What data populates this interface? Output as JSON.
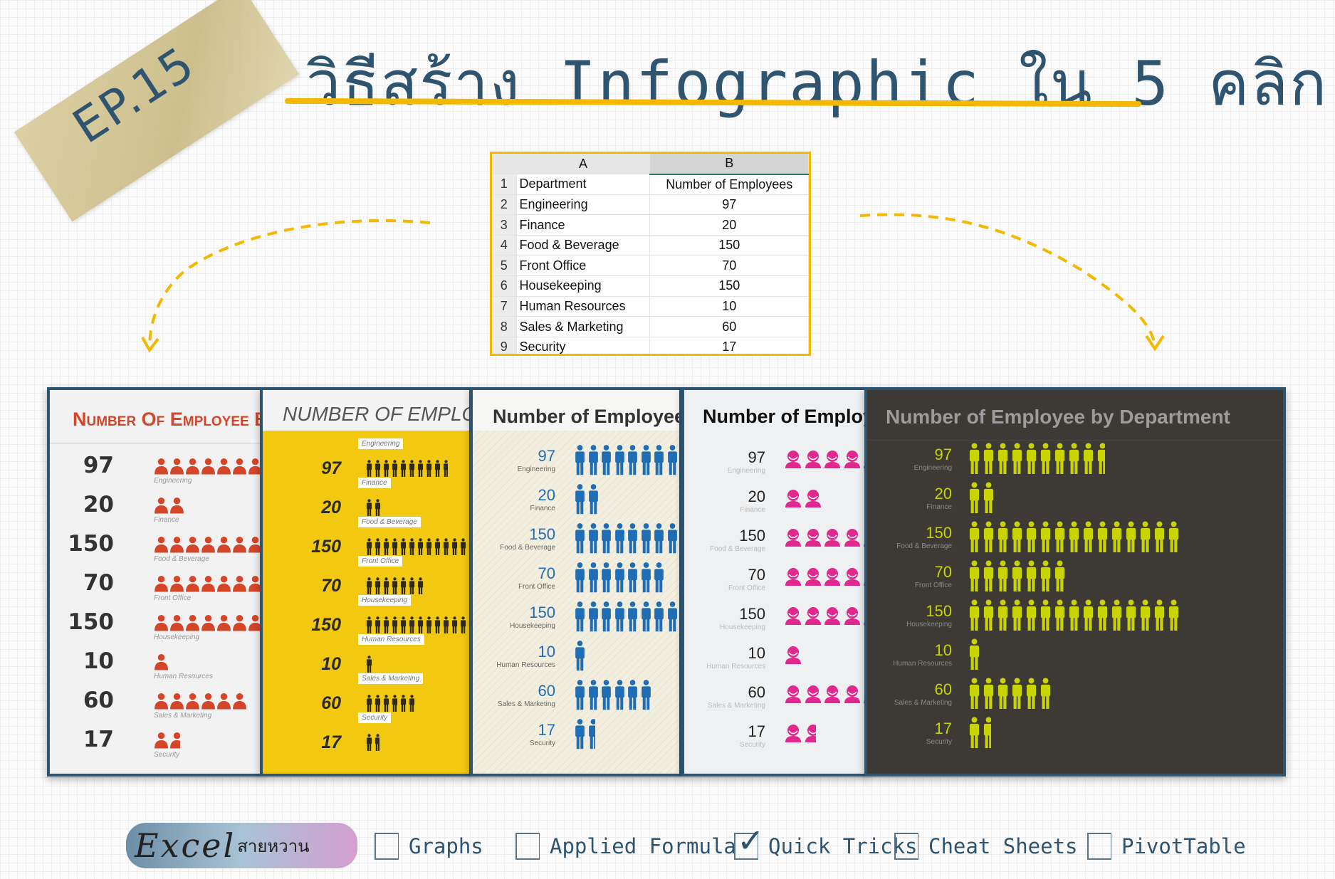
{
  "badge": {
    "text": "EP.15"
  },
  "header": {
    "title": "วิธีสร้าง Infographic ใน 5 คลิก!"
  },
  "spreadsheet": {
    "col_headers": [
      "A",
      "B"
    ],
    "rows": [
      {
        "n": "1",
        "a": "Department",
        "b": "Number of Employees"
      },
      {
        "n": "2",
        "a": "Engineering",
        "b": "97"
      },
      {
        "n": "3",
        "a": "Finance",
        "b": "20"
      },
      {
        "n": "4",
        "a": "Food & Beverage",
        "b": "150"
      },
      {
        "n": "5",
        "a": "Front Office",
        "b": "70"
      },
      {
        "n": "6",
        "a": "Housekeeping",
        "b": "150"
      },
      {
        "n": "7",
        "a": "Human Resources",
        "b": "10"
      },
      {
        "n": "8",
        "a": "Sales & Marketing",
        "b": "60"
      },
      {
        "n": "9",
        "a": "Security",
        "b": "17"
      }
    ]
  },
  "chart_data": {
    "type": "pictograph",
    "title": "Number of Employee by Department",
    "categories": [
      "Engineering",
      "Finance",
      "Food & Beverage",
      "Front Office",
      "Housekeeping",
      "Human Resources",
      "Sales & Marketing",
      "Security"
    ],
    "values": [
      97,
      20,
      150,
      70,
      150,
      10,
      60,
      17
    ],
    "units_per_icon": 10,
    "variants": [
      {
        "style": "red-people",
        "icon": "person-icon",
        "color": "#d4462a",
        "background": "#f2f2f2"
      },
      {
        "style": "yellow-callout",
        "icon": "person-icon",
        "color": "#2a2a2a",
        "background": "#f2c811"
      },
      {
        "style": "blue-people",
        "icon": "person-icon",
        "color": "#1f6db5",
        "background": "#f3efe0"
      },
      {
        "style": "pink-avatars",
        "icon": "avatar-icon",
        "color": "#e0288f",
        "background": "#eef0f2"
      },
      {
        "style": "lime-dark",
        "icon": "person-icon",
        "color": "#c8d400",
        "background": "#3d3935"
      }
    ]
  },
  "colors": {
    "accent_yellow": "#f5b800",
    "navy": "#2f5470"
  },
  "footer": {
    "logo_latin": "Excel",
    "logo_thai": "สายหวาน",
    "categories": [
      {
        "label": "Graphs",
        "checked": false
      },
      {
        "label": "Applied Formula",
        "checked": false
      },
      {
        "label": "Quick Tricks",
        "checked": true
      },
      {
        "label": "Cheat Sheets",
        "checked": false
      },
      {
        "label": "PivotTable",
        "checked": false
      }
    ],
    "check_mark": "✓"
  }
}
